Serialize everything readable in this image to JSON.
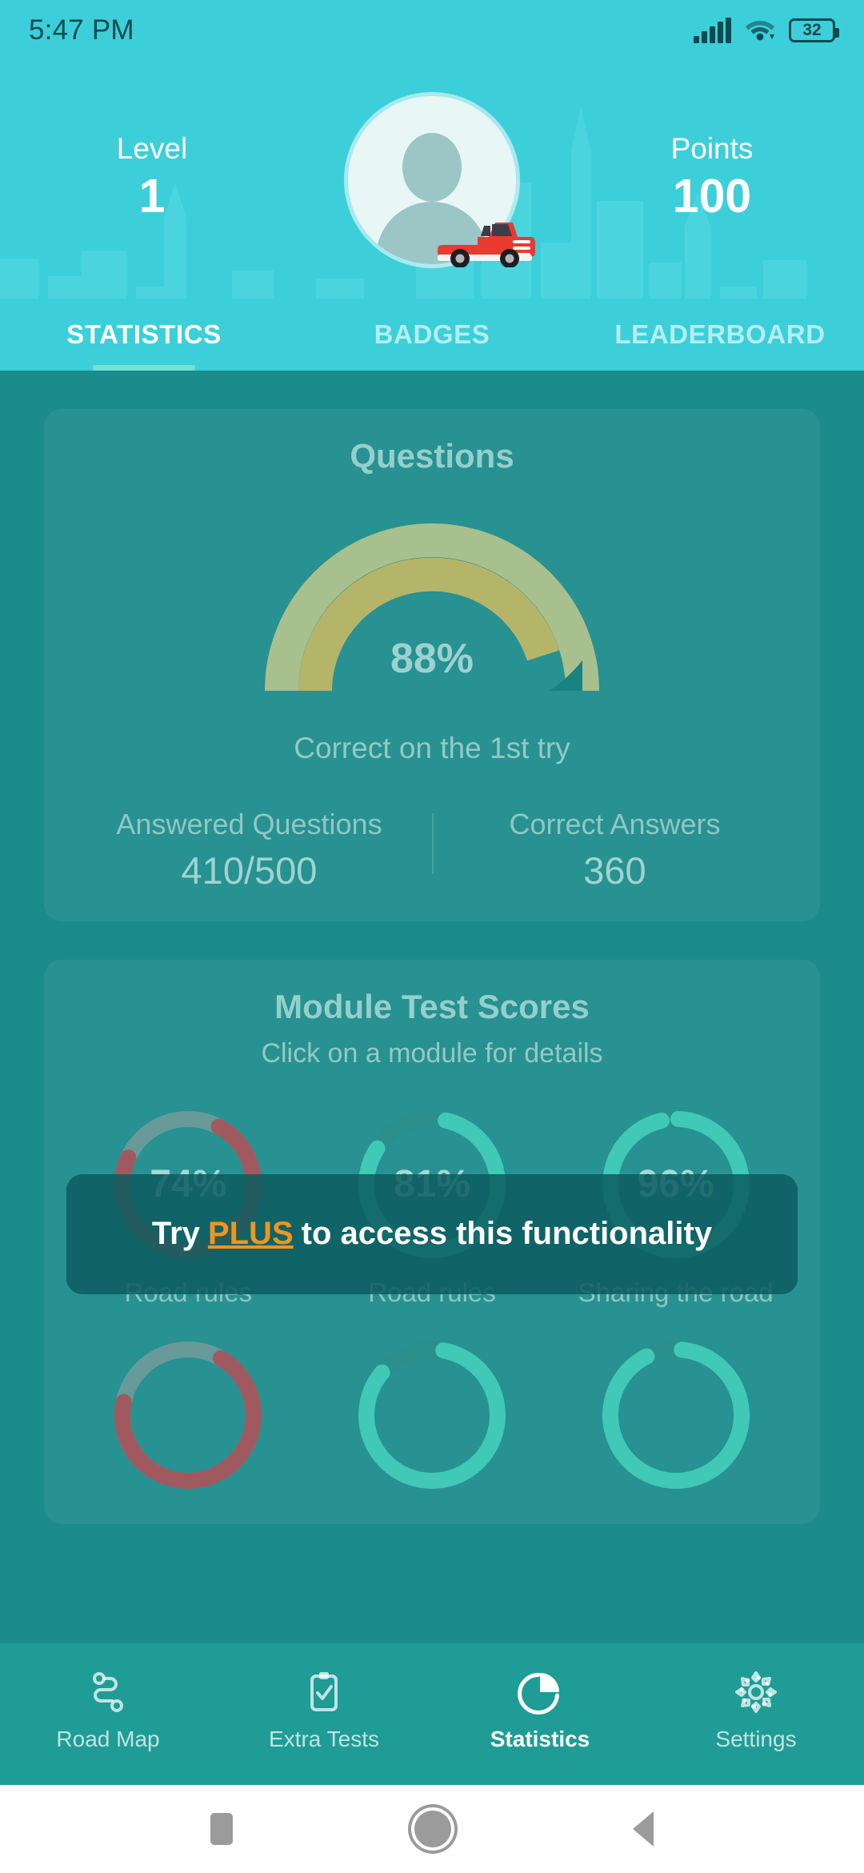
{
  "statusbar": {
    "time": "5:47 PM",
    "battery_level": "32",
    "icons": [
      "signal-icon",
      "wifi-icon",
      "battery-icon"
    ]
  },
  "header": {
    "level_label": "Level",
    "level_value": "1",
    "points_label": "Points",
    "points_value": "100",
    "avatar_icon": "user-avatar",
    "vehicle_icon": "red-pickup-truck"
  },
  "tabs": [
    {
      "label": "STATISTICS",
      "active": true
    },
    {
      "label": "BADGES",
      "active": false
    },
    {
      "label": "LEADERBOARD",
      "active": false
    }
  ],
  "questions_card": {
    "title": "Questions",
    "gauge_percent": "88%",
    "gauge_caption": "Correct on the 1st try",
    "stats": [
      {
        "label": "Answered Questions",
        "value": "410/500"
      },
      {
        "label": "Correct Answers",
        "value": "360"
      }
    ]
  },
  "modules_card": {
    "title": "Module Test Scores",
    "subtitle": "Click on a module for details",
    "modules": [
      {
        "percent": "74%",
        "label": "Road rules"
      },
      {
        "percent": "81%",
        "label": "Road rules"
      },
      {
        "percent": "96%",
        "label": "Sharing the road"
      }
    ]
  },
  "plus_banner": {
    "prefix": "Try",
    "plus": "PLUS",
    "suffix": "to access this functionality"
  },
  "bottom_nav": [
    {
      "label": "Road Map",
      "icon": "road-map-icon",
      "active": false
    },
    {
      "label": "Extra Tests",
      "icon": "clipboard-check-icon",
      "active": false
    },
    {
      "label": "Statistics",
      "icon": "pie-chart-icon",
      "active": true
    },
    {
      "label": "Settings",
      "icon": "gear-icon",
      "active": false
    }
  ],
  "android_nav": [
    {
      "icon": "recents-square-icon"
    },
    {
      "icon": "home-circle-icon"
    },
    {
      "icon": "back-triangle-icon"
    }
  ],
  "chart_data": [
    {
      "type": "gauge",
      "title": "Questions",
      "value": 88,
      "ylim": [
        0,
        100
      ],
      "unit": "%",
      "annotation": "Correct on the 1st try",
      "track_color": "#a8c08d",
      "fill_color": "#b5b56a",
      "answered": "410/500",
      "correct": 360
    },
    {
      "type": "donut",
      "title": "Module Test Scores",
      "subtitle": "Click on a module for details",
      "categories": [
        "Road rules",
        "Road rules",
        "Sharing the road"
      ],
      "values": [
        74,
        81,
        96
      ],
      "ylim": [
        0,
        100
      ],
      "colors": [
        "#a05a5f",
        "#3fbfae",
        "#3fbfae"
      ]
    }
  ],
  "colors": {
    "header_teal": "#3ccfd9",
    "body_teal": "#1c8b8b",
    "nav_teal": "#1f9c96",
    "accent_orange": "#f0951f",
    "tab_underline": "#6fe3d8"
  }
}
